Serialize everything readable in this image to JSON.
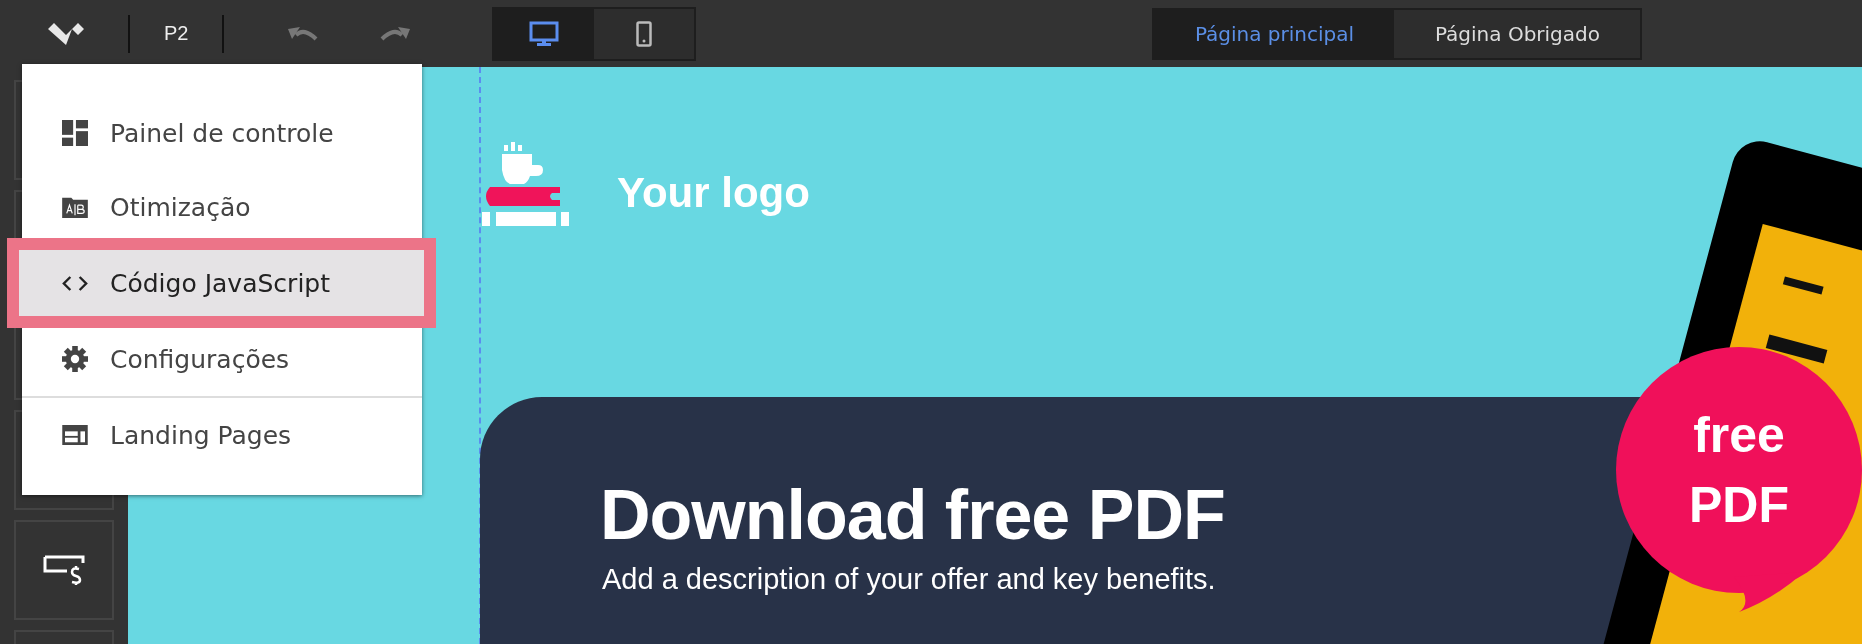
{
  "toolbar": {
    "project": "P2",
    "devices": [
      {
        "kind": "desktop",
        "selected": true
      },
      {
        "kind": "mobile",
        "selected": false
      }
    ],
    "pages": [
      {
        "label": "Página principal",
        "selected": true
      },
      {
        "label": "Página Obrigado",
        "selected": false
      }
    ]
  },
  "sidebar": {
    "tiles": [
      {
        "kind": "blank"
      },
      {
        "kind": "blank"
      },
      {
        "kind": "blank"
      },
      {
        "kind": "blank"
      },
      {
        "kind": "price"
      },
      {
        "kind": "blank"
      }
    ]
  },
  "menu": {
    "items": [
      {
        "kind": "dashboard",
        "label": "Painel de controle",
        "selected": false,
        "divider_before": false
      },
      {
        "kind": "ab",
        "label": "Otimização",
        "selected": false,
        "divider_before": false
      },
      {
        "kind": "code",
        "label": "Código JavaScript",
        "selected": true,
        "divider_before": false
      },
      {
        "kind": "gear",
        "label": "Configurações",
        "selected": false,
        "divider_before": false
      },
      {
        "kind": "pages",
        "label": "Landing Pages",
        "selected": false,
        "divider_before": true
      }
    ]
  },
  "canvas": {
    "logo_text": "Your logo",
    "headline": "Download free PDF",
    "description": "Add a description of your offer and key benefits.",
    "badge": [
      "free",
      "PDF"
    ]
  }
}
